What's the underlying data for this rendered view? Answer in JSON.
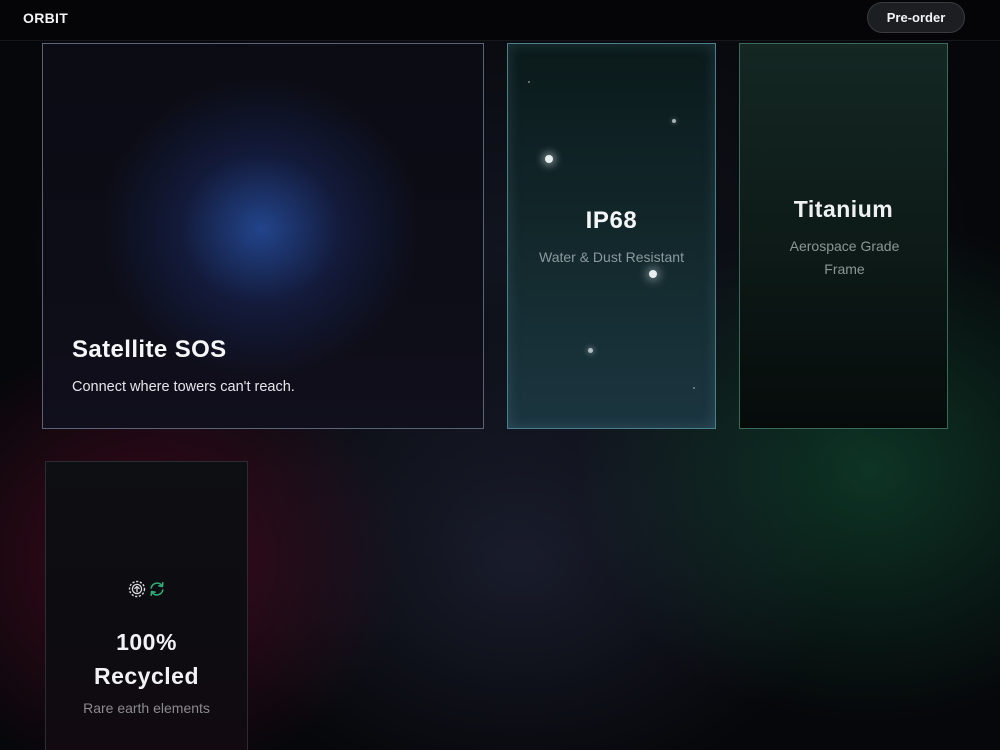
{
  "header": {
    "brand": "ORBIT",
    "preorder_label": "Pre-order"
  },
  "cards": {
    "sos": {
      "title": "Satellite SOS",
      "subtitle": "Connect where towers can't reach."
    },
    "ip68": {
      "title": "IP68",
      "subtitle": "Water & Dust Resistant"
    },
    "titanium": {
      "title": "Titanium",
      "subtitle": "Aerospace Grade Frame"
    },
    "recycled": {
      "title_line1": "100%",
      "title_line2": "Recycled",
      "subtitle": "Rare earth elements",
      "icons": [
        "upload-circle-icon",
        "recycle-arrows-icon"
      ]
    }
  },
  "colors": {
    "accent_green": "#2fae7a",
    "card_border_ip": "#4a7e8a",
    "card_border_titanium": "#3a6a5a"
  }
}
